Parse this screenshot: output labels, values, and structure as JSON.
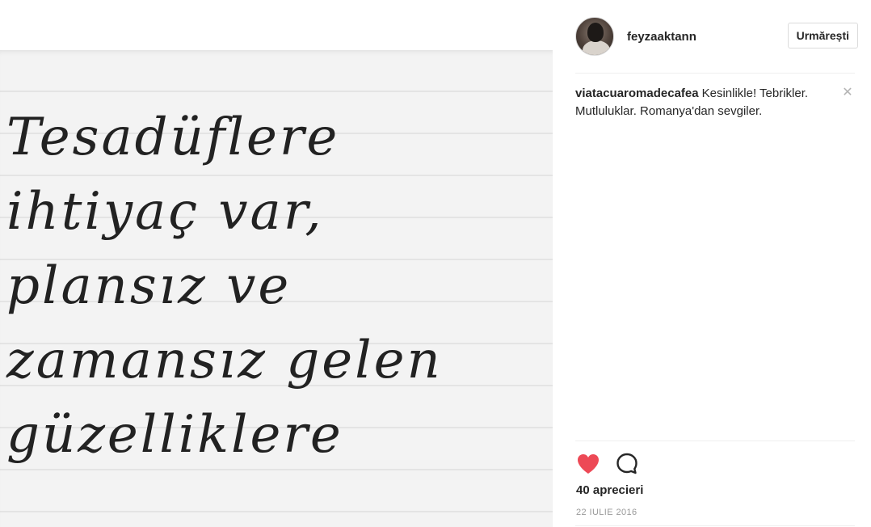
{
  "post": {
    "image_text_lines": [
      "Tesadüflere",
      "ihtiyaç var,",
      "plansız ve",
      "zamansız gelen",
      "güzelliklere"
    ]
  },
  "header": {
    "username": "feyzaaktann",
    "follow_label": "Urmărești"
  },
  "comments": [
    {
      "user": "viatacuaromadecafea",
      "text": "Kesinlikle! Tebrikler. Mutluluklar. Romanya'dan sevgiler."
    }
  ],
  "actions": {
    "like_icon": "heart-filled-icon",
    "comment_icon": "speech-bubble-icon",
    "like_color": "#ed4956"
  },
  "likes_label": "40 aprecieri",
  "date_label": "22 IULIE 2016"
}
